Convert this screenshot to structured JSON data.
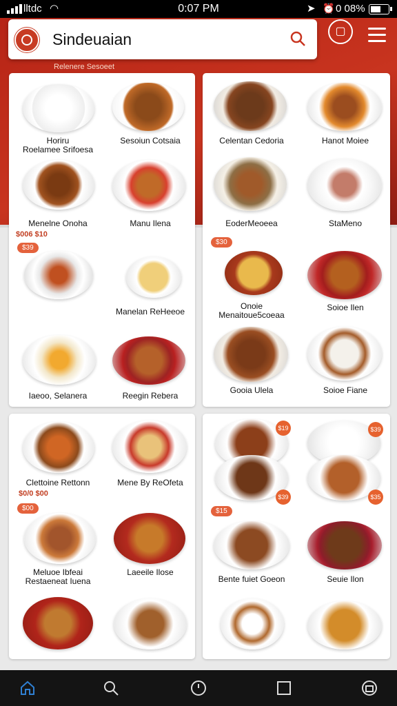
{
  "status_bar": {
    "carrier": "lltdc",
    "time": "0:07 PM",
    "battery": "0 08%"
  },
  "header": {
    "title": "Sindeuaian",
    "subtitle": "Relenere Sesoeet"
  },
  "icons": {
    "search": "search-icon",
    "cart": "cart-icon",
    "menu": "hamburger-icon"
  },
  "colors": {
    "accent": "#c8341f",
    "badge": "#e4623c"
  },
  "cards": [
    {
      "dishes": [
        {
          "label": "Horiru\nRoelamee Srifoesa"
        },
        {
          "label": "Sesoiun Cotsaia"
        },
        {
          "label": "Menelne Onoha"
        },
        {
          "label": "Manu Ilena"
        },
        {
          "label": ""
        },
        {
          "label": "Manelan ReHeeoe"
        },
        {
          "label": "Iaeoo, Selanera"
        },
        {
          "label": "Reegin Rebera"
        }
      ],
      "price": "$006 $10",
      "badge": "$39"
    },
    {
      "dishes": [
        {
          "label": "Celentan Cedoria"
        },
        {
          "label": "Hanot Moiee"
        },
        {
          "label": "EoderMeoeea"
        },
        {
          "label": "StaMeno"
        },
        {
          "label": "Onoie\nMenaitoue5coeaa"
        },
        {
          "label": "Soioe Ilen"
        },
        {
          "label": "Gooia Ulela"
        },
        {
          "label": "Soioe Fiane"
        }
      ],
      "badge": "$30"
    },
    {
      "dishes": [
        {
          "label": "Clettoine Rettonn"
        },
        {
          "label": "Mene By ReOfeta"
        },
        {
          "label": "Meluoe Ibfeai\nRestaeneat Iuena"
        },
        {
          "label": "Laeeile Ilose"
        },
        {
          "label": ""
        },
        {
          "label": ""
        }
      ],
      "price": "$0/0 $00",
      "badge": "$00"
    },
    {
      "dishes": [
        {
          "label": ""
        },
        {
          "label": ""
        },
        {
          "label": "Bente fuiet Goeon"
        },
        {
          "label": "Seuie Ilon"
        },
        {
          "label": ""
        },
        {
          "label": ""
        }
      ],
      "badges": [
        "$19",
        "$39",
        "$39",
        "$35",
        "$15"
      ]
    }
  ],
  "bottom_nav": [
    "home-icon",
    "search-icon",
    "clock-icon",
    "square-icon",
    "cart-icon"
  ]
}
